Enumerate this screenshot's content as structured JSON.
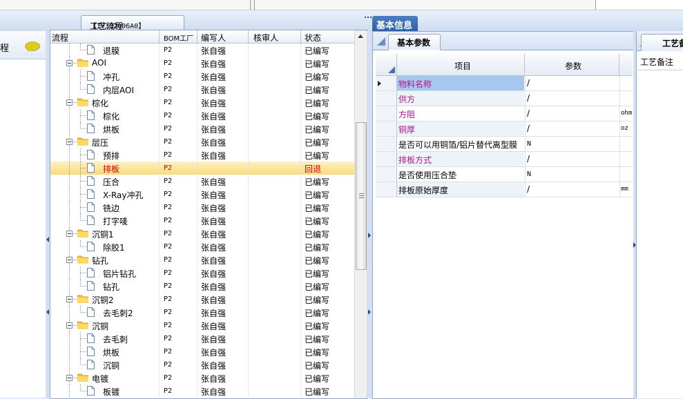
{
  "tree_tab": {
    "code": "【IV3Q2006A0】",
    "label": "工艺流程"
  },
  "left_panel": {
    "title": "程"
  },
  "tree": {
    "columns": [
      "流程",
      "BOM工厂",
      "编写人",
      "核审人",
      "状态"
    ],
    "rows": [
      {
        "name": "退膜",
        "type": "doc",
        "level": 2,
        "factory": "P2",
        "author": "张自强",
        "reviewer": "",
        "status": "已编写"
      },
      {
        "name": "AOI",
        "type": "folder",
        "level": 1,
        "factory": "P2",
        "author": "张自强",
        "reviewer": "",
        "status": "已编写"
      },
      {
        "name": "冲孔",
        "type": "doc",
        "level": 2,
        "factory": "P2",
        "author": "张自强",
        "reviewer": "",
        "status": "已编写"
      },
      {
        "name": "内层AOI",
        "type": "doc",
        "level": 2,
        "factory": "P2",
        "author": "张自强",
        "reviewer": "",
        "status": "已编写"
      },
      {
        "name": "棕化",
        "type": "folder",
        "level": 1,
        "factory": "P2",
        "author": "张自强",
        "reviewer": "",
        "status": "已编写"
      },
      {
        "name": "棕化",
        "type": "doc",
        "level": 2,
        "factory": "P2",
        "author": "张自强",
        "reviewer": "",
        "status": "已编写"
      },
      {
        "name": "烘板",
        "type": "doc",
        "level": 2,
        "factory": "P2",
        "author": "张自强",
        "reviewer": "",
        "status": "已编写"
      },
      {
        "name": "层压",
        "type": "folder",
        "level": 1,
        "factory": "P2",
        "author": "张自强",
        "reviewer": "",
        "status": "已编写"
      },
      {
        "name": "预排",
        "type": "doc",
        "level": 2,
        "factory": "P2",
        "author": "张自强",
        "reviewer": "",
        "status": "已编写"
      },
      {
        "name": "排板",
        "type": "doc",
        "level": 2,
        "factory": "P2",
        "author": "",
        "reviewer": "",
        "status": "回退",
        "selected": true
      },
      {
        "name": "压合",
        "type": "doc",
        "level": 2,
        "factory": "P2",
        "author": "张自强",
        "reviewer": "",
        "status": "已编写"
      },
      {
        "name": "X-Ray冲孔",
        "type": "doc",
        "level": 2,
        "factory": "P2",
        "author": "张自强",
        "reviewer": "",
        "status": "已编写"
      },
      {
        "name": "铣边",
        "type": "doc",
        "level": 2,
        "factory": "P2",
        "author": "张自强",
        "reviewer": "",
        "status": "已编写"
      },
      {
        "name": "打字唛",
        "type": "doc",
        "level": 2,
        "factory": "P2",
        "author": "张自强",
        "reviewer": "",
        "status": "已编写"
      },
      {
        "name": "沉铜1",
        "type": "folder",
        "level": 1,
        "factory": "P2",
        "author": "张自强",
        "reviewer": "",
        "status": "已编写"
      },
      {
        "name": "除胶1",
        "type": "doc",
        "level": 2,
        "factory": "P2",
        "author": "张自强",
        "reviewer": "",
        "status": "已编写"
      },
      {
        "name": "钻孔",
        "type": "folder",
        "level": 1,
        "factory": "P2",
        "author": "张自强",
        "reviewer": "",
        "status": "已编写"
      },
      {
        "name": "铝片钻孔",
        "type": "doc",
        "level": 2,
        "factory": "P2",
        "author": "张自强",
        "reviewer": "",
        "status": "已编写"
      },
      {
        "name": "钻孔",
        "type": "doc",
        "level": 2,
        "factory": "P2",
        "author": "张自强",
        "reviewer": "",
        "status": "已编写"
      },
      {
        "name": "沉铜2",
        "type": "folder",
        "level": 1,
        "factory": "P2",
        "author": "张自强",
        "reviewer": "",
        "status": "已编写"
      },
      {
        "name": "去毛刺2",
        "type": "doc",
        "level": 2,
        "factory": "P2",
        "author": "张自强",
        "reviewer": "",
        "status": "已编写"
      },
      {
        "name": "沉铜",
        "type": "folder",
        "level": 1,
        "factory": "P2",
        "author": "张自强",
        "reviewer": "",
        "status": "已编写"
      },
      {
        "name": "去毛刺",
        "type": "doc",
        "level": 2,
        "factory": "P2",
        "author": "张自强",
        "reviewer": "",
        "status": "已编写"
      },
      {
        "name": "烘板",
        "type": "doc",
        "level": 2,
        "factory": "P2",
        "author": "张自强",
        "reviewer": "",
        "status": "已编写"
      },
      {
        "name": "沉铜",
        "type": "doc",
        "level": 2,
        "factory": "P2",
        "author": "张自强",
        "reviewer": "",
        "status": "已编写"
      },
      {
        "name": "电镀",
        "type": "folder",
        "level": 1,
        "factory": "P2",
        "author": "张自强",
        "reviewer": "",
        "status": "已编写"
      },
      {
        "name": "板镀",
        "type": "doc",
        "level": 2,
        "factory": "P2",
        "author": "张自强",
        "reviewer": "",
        "status": "已编写"
      }
    ]
  },
  "info_tab": {
    "label": "基本信息"
  },
  "param_tab": {
    "label": "基本参数"
  },
  "param_grid": {
    "columns": [
      "项目",
      "参数"
    ],
    "rows": [
      {
        "name": "物料名称",
        "value": "/",
        "unit": "",
        "pink": true,
        "selected": true
      },
      {
        "name": "供方",
        "value": "/",
        "unit": "",
        "pink": true
      },
      {
        "name": "方阻",
        "value": "/",
        "unit": "ohm",
        "pink": true
      },
      {
        "name": "铜厚",
        "value": "/",
        "unit": "oz",
        "pink": true
      },
      {
        "name": "是否可以用铜箔/铝片替代离型膜",
        "value": "N",
        "unit": "",
        "pink": false
      },
      {
        "name": "排板方式",
        "value": "/",
        "unit": "",
        "pink": true
      },
      {
        "name": "是否使用压合垫",
        "value": "N",
        "unit": "",
        "pink": false
      },
      {
        "name": "排板原始厚度",
        "value": "/",
        "unit": "mm",
        "pink": false
      }
    ]
  },
  "remark": {
    "tab_label": "工艺备注",
    "field_label": "工艺备注"
  },
  "colors": {
    "selected_row": "#fcd97b",
    "rollback_text": "#d40000",
    "pink_label": "#b0168c",
    "header_blue": "#2b5fa6"
  }
}
